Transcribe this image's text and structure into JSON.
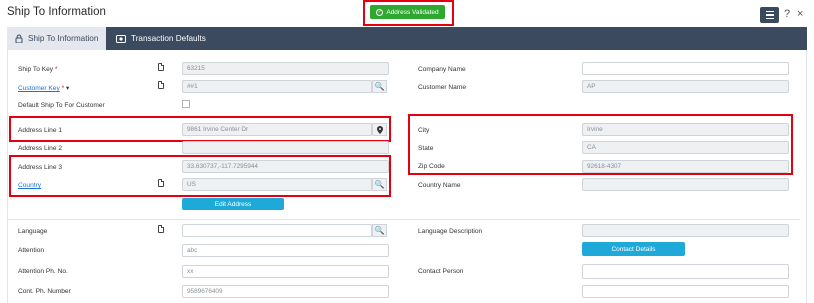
{
  "header": {
    "title": "Ship To Information",
    "badge": "Address Validated",
    "help": "?",
    "close": "×"
  },
  "tabs": [
    {
      "label": "Ship To Information",
      "active": true
    },
    {
      "label": "Transaction Defaults",
      "active": false
    }
  ],
  "left": {
    "ship_to_key_label": "Ship To Key",
    "ship_to_key_value": "63215",
    "customer_key_label": "Customer Key",
    "customer_key_value": "##1",
    "default_ship_label": "Default Ship To For Customer",
    "address1_label": "Address Line 1",
    "address1_value": "9861 Irvine Center Dr",
    "address2_label": "Address Line 2",
    "address2_value": "",
    "address3_label": "Address Line 3",
    "address3_value": "33.630737,-117.7295944",
    "country_label": "Country",
    "country_value": "US",
    "edit_address": "Edit Address",
    "language_label": "Language",
    "language_value": "",
    "attention_label": "Attention",
    "attention_value": "abc",
    "attention_ph_label": "Attention Ph. No.",
    "attention_ph_value": "xx",
    "cont_ph_label": "Cont. Ph. Number",
    "cont_ph_value": "9589676409"
  },
  "right": {
    "company_label": "Company Name",
    "company_value": "",
    "customer_name_label": "Customer Name",
    "customer_name_value": "AP",
    "city_label": "City",
    "city_value": "Irvine",
    "state_label": "State",
    "state_value": "CA",
    "zip_label": "Zip Code",
    "zip_value": "92618-4307",
    "country_name_label": "Country Name",
    "country_name_value": "",
    "lang_desc_label": "Language Description",
    "lang_desc_value": "",
    "contact_details": "Contact Details",
    "contact_person_label": "Contact Person",
    "contact_person_value": ""
  },
  "colors": {
    "accent": "#3b4a5f",
    "badge": "#2fa82f",
    "button": "#1fa9d9",
    "highlight": "#e3000f"
  }
}
